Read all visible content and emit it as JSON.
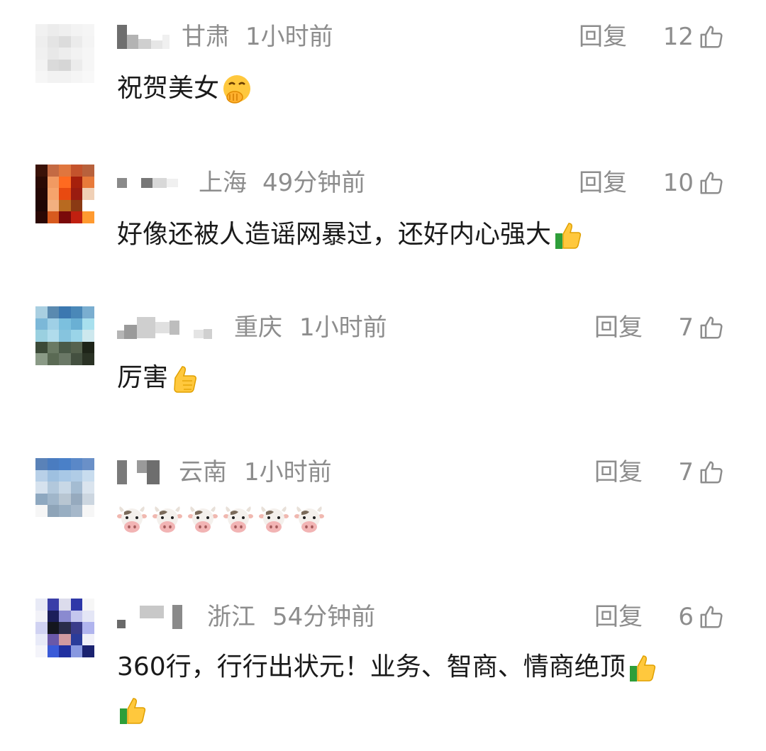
{
  "comments": [
    {
      "location": "甘肃",
      "time": "1小时前",
      "reply_label": "回复",
      "likes": "12",
      "text": "祝贺美女",
      "emoji": "hand-over-mouth-emoji"
    },
    {
      "location": "上海",
      "time": "49分钟前",
      "reply_label": "回复",
      "likes": "10",
      "text": "好像还被人造谣网暴过，还好内心强大",
      "emoji": "thumbs-up-emoji"
    },
    {
      "location": "重庆",
      "time": "1小时前",
      "reply_label": "回复",
      "likes": "7",
      "text": "厉害",
      "emoji": "thumbs-up-emoji"
    },
    {
      "location": "云南",
      "time": "1小时前",
      "reply_label": "回复",
      "likes": "7",
      "text": "",
      "emoji": "cow-face-emoji",
      "emoji_count": 6
    },
    {
      "location": "浙江",
      "time": "54分钟前",
      "reply_label": "回复",
      "likes": "6",
      "text": "360行，行行出状元！业务、智商、情商绝顶",
      "emoji": "thumbs-up-emoji"
    }
  ],
  "colors": {
    "meta_text": "#8d8d8d",
    "body_text": "#1a1a1a",
    "background": "#ffffff"
  }
}
